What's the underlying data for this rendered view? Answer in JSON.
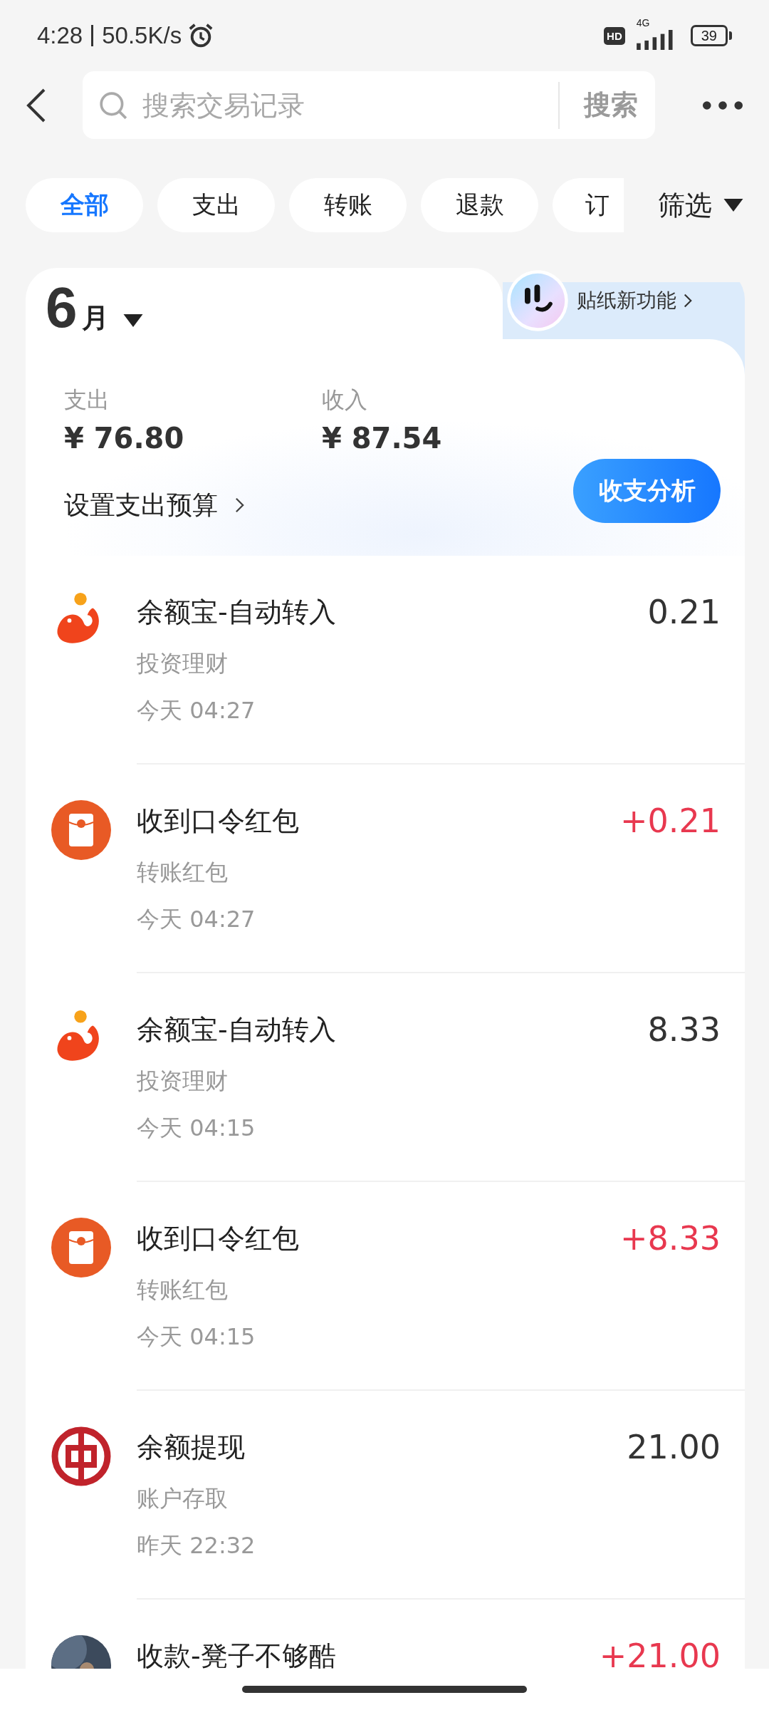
{
  "status_bar": {
    "time": "4:28",
    "speed": "50.5K/s",
    "hd": "HD",
    "network": "4G",
    "battery": "39"
  },
  "search": {
    "placeholder": "搜索交易记录",
    "button": "搜索"
  },
  "tabs": [
    {
      "label": "全部",
      "selected": true
    },
    {
      "label": "支出",
      "selected": false
    },
    {
      "label": "转账",
      "selected": false
    },
    {
      "label": "退款",
      "selected": false
    },
    {
      "label": "订",
      "selected": false
    }
  ],
  "filter": "筛选",
  "summary": {
    "month": "6",
    "month_unit": "月",
    "sticker_link": "贴纸新功能",
    "expense_label": "支出",
    "expense": "¥ 76.80",
    "income_label": "收入",
    "income": "¥ 87.54",
    "budget_link": "设置支出预算",
    "analysis_button": "收支分析"
  },
  "transactions": [
    {
      "kind": "fish",
      "title": "余额宝-自动转入",
      "category": "投资理财",
      "time": "今天 04:27",
      "amount": "0.21",
      "income": false
    },
    {
      "kind": "red-packet",
      "title": "收到口令红包",
      "category": "转账红包",
      "time": "今天 04:27",
      "amount": "+0.21",
      "income": true
    },
    {
      "kind": "fish",
      "title": "余额宝-自动转入",
      "category": "投资理财",
      "time": "今天 04:15",
      "amount": "8.33",
      "income": false
    },
    {
      "kind": "red-packet",
      "title": "收到口令红包",
      "category": "转账红包",
      "time": "今天 04:15",
      "amount": "+8.33",
      "income": true
    },
    {
      "kind": "bank",
      "title": "余额提现",
      "category": "账户存取",
      "time": "昨天 22:32",
      "amount": "21.00",
      "income": false
    },
    {
      "kind": "picture",
      "title": "收款-凳子不够酷",
      "amount": "+21.00",
      "income": true
    }
  ]
}
